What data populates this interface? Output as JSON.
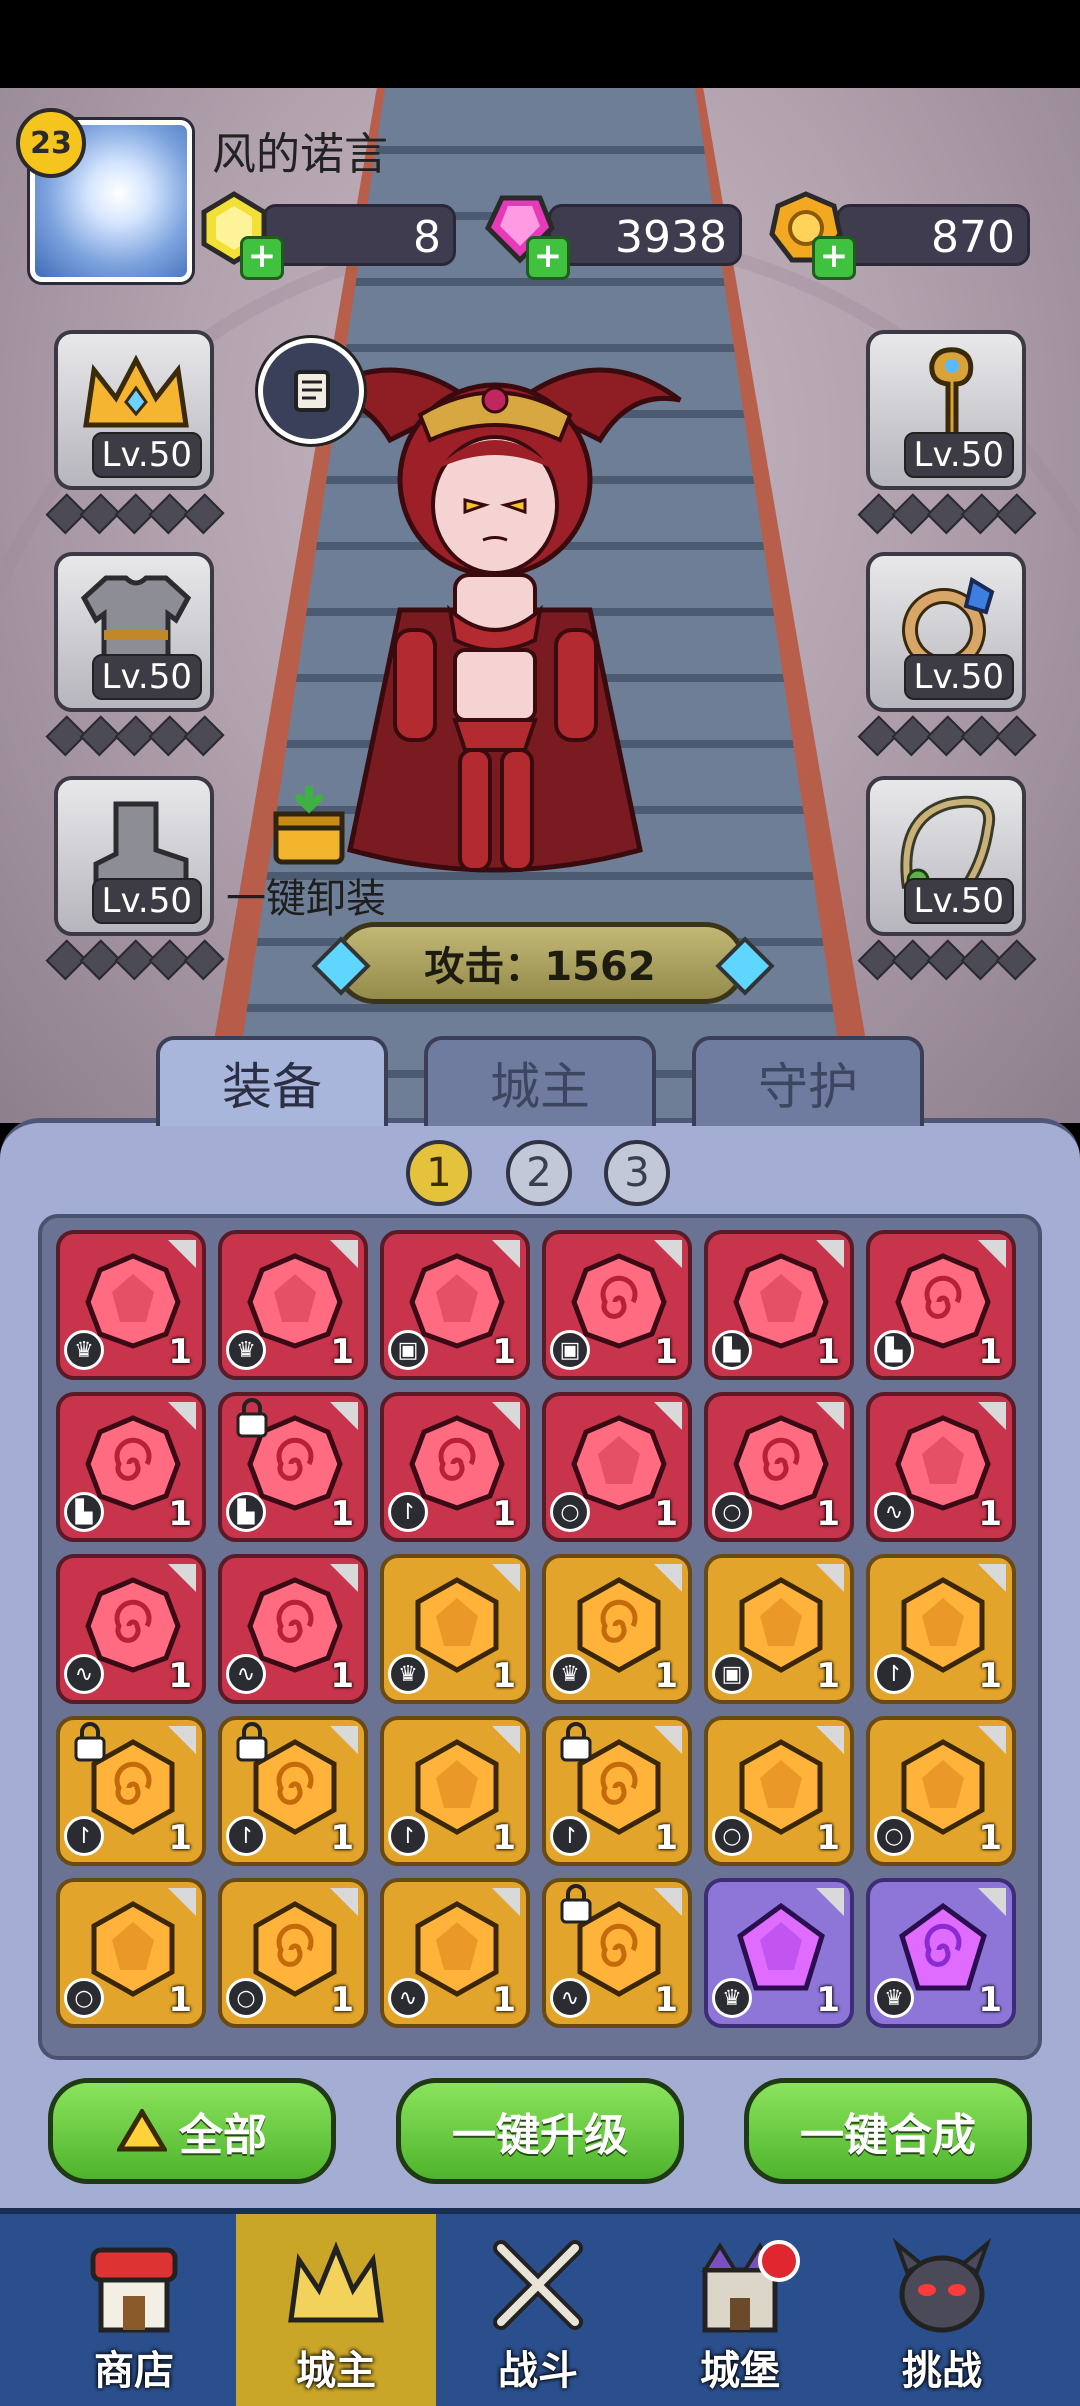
{
  "player": {
    "level": "23",
    "name": "风的诺言"
  },
  "resources": [
    {
      "name": "gold-crystal",
      "value": "8"
    },
    {
      "name": "pink-gem",
      "value": "3938"
    },
    {
      "name": "coin",
      "value": "870"
    }
  ],
  "equipment_slots": [
    {
      "slot": "crown",
      "level": "Lv.50"
    },
    {
      "slot": "armor",
      "level": "Lv.50"
    },
    {
      "slot": "boots",
      "level": "Lv.50"
    },
    {
      "slot": "staff",
      "level": "Lv.50"
    },
    {
      "slot": "ring",
      "level": "Lv.50"
    },
    {
      "slot": "necklace",
      "level": "Lv.50"
    }
  ],
  "unequip_label": "一键卸装",
  "attack_label": "攻击：1562",
  "tabs": [
    "装备",
    "城主",
    "守护"
  ],
  "pages": [
    "1",
    "2",
    "3"
  ],
  "active_page": "1",
  "inventory": [
    {
      "color": "red",
      "swirl": false,
      "slot": "crown",
      "count": "1",
      "locked": false
    },
    {
      "color": "red",
      "swirl": false,
      "slot": "crown",
      "count": "1",
      "locked": false
    },
    {
      "color": "red",
      "swirl": false,
      "slot": "armor",
      "count": "1",
      "locked": false
    },
    {
      "color": "red",
      "swirl": true,
      "slot": "armor",
      "count": "1",
      "locked": false
    },
    {
      "color": "red",
      "swirl": false,
      "slot": "boots",
      "count": "1",
      "locked": false
    },
    {
      "color": "red",
      "swirl": true,
      "slot": "boots",
      "count": "1",
      "locked": false
    },
    {
      "color": "red",
      "swirl": true,
      "slot": "boots",
      "count": "1",
      "locked": false
    },
    {
      "color": "red",
      "swirl": true,
      "slot": "boots",
      "count": "1",
      "locked": true
    },
    {
      "color": "red",
      "swirl": true,
      "slot": "staff",
      "count": "1",
      "locked": false
    },
    {
      "color": "red",
      "swirl": false,
      "slot": "ring",
      "count": "1",
      "locked": false
    },
    {
      "color": "red",
      "swirl": true,
      "slot": "ring",
      "count": "1",
      "locked": false
    },
    {
      "color": "red",
      "swirl": false,
      "slot": "necklace",
      "count": "1",
      "locked": false
    },
    {
      "color": "red",
      "swirl": true,
      "slot": "necklace",
      "count": "1",
      "locked": false
    },
    {
      "color": "red",
      "swirl": true,
      "slot": "necklace",
      "count": "1",
      "locked": false
    },
    {
      "color": "gold",
      "swirl": false,
      "slot": "crown",
      "count": "1",
      "locked": false
    },
    {
      "color": "gold",
      "swirl": true,
      "slot": "crown",
      "count": "1",
      "locked": false
    },
    {
      "color": "gold",
      "swirl": false,
      "slot": "armor",
      "count": "1",
      "locked": false
    },
    {
      "color": "gold",
      "swirl": false,
      "slot": "staff",
      "count": "1",
      "locked": false
    },
    {
      "color": "gold",
      "swirl": true,
      "slot": "staff",
      "count": "1",
      "locked": true
    },
    {
      "color": "gold",
      "swirl": true,
      "slot": "staff",
      "count": "1",
      "locked": true
    },
    {
      "color": "gold",
      "swirl": false,
      "slot": "staff",
      "count": "1",
      "locked": false
    },
    {
      "color": "gold",
      "swirl": true,
      "slot": "staff",
      "count": "1",
      "locked": true
    },
    {
      "color": "gold",
      "swirl": false,
      "slot": "ring",
      "count": "1",
      "locked": false
    },
    {
      "color": "gold",
      "swirl": false,
      "slot": "ring",
      "count": "1",
      "locked": false
    },
    {
      "color": "gold",
      "swirl": false,
      "slot": "ring",
      "count": "1",
      "locked": false
    },
    {
      "color": "gold",
      "swirl": true,
      "slot": "ring",
      "count": "1",
      "locked": false
    },
    {
      "color": "gold",
      "swirl": false,
      "slot": "necklace",
      "count": "1",
      "locked": false
    },
    {
      "color": "gold",
      "swirl": true,
      "slot": "necklace",
      "count": "1",
      "locked": true
    },
    {
      "color": "purple",
      "swirl": false,
      "slot": "crown",
      "count": "1",
      "locked": false
    },
    {
      "color": "purple",
      "swirl": true,
      "slot": "crown",
      "count": "1",
      "locked": false
    }
  ],
  "buttons": {
    "all": "全部",
    "upgrade": "一键升级",
    "merge": "一键合成"
  },
  "nav": [
    {
      "label": "商店",
      "icon": "shop-icon"
    },
    {
      "label": "城主",
      "icon": "crown-icon"
    },
    {
      "label": "战斗",
      "icon": "swords-icon"
    },
    {
      "label": "城堡",
      "icon": "castle-icon"
    },
    {
      "label": "挑战",
      "icon": "demon-icon"
    }
  ],
  "active_nav": "城主",
  "colors": {
    "red_gem": "#c7344b",
    "gold_gem": "#e2a42a",
    "purple_gem": "#8e76d8",
    "panel": "#a4aed4",
    "nav": "#2b4f8c",
    "nav_active": "#c9a528",
    "green_button": "#5cc03a"
  }
}
